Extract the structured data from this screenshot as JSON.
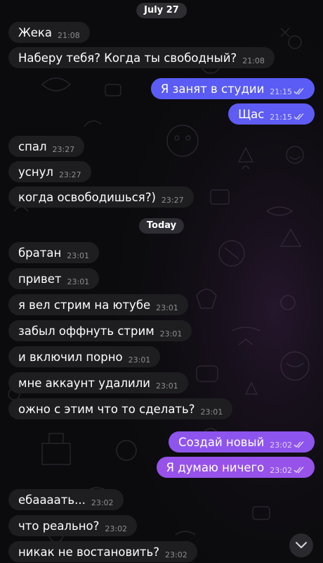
{
  "dates": {
    "first": "July 27",
    "second": "Today"
  },
  "messages": [
    {
      "text": "Жека",
      "time": "21:08",
      "dir": "in"
    },
    {
      "text": "Наберу тебя? Когда ты свободный?",
      "time": "21:08",
      "dir": "in"
    },
    {
      "text": "Я занят в студии",
      "time": "21:15",
      "dir": "out"
    },
    {
      "text": "Щас",
      "time": "21:15",
      "dir": "out"
    },
    {
      "text": "спал",
      "time": "23:27",
      "dir": "in"
    },
    {
      "text": "уснул",
      "time": "23:27",
      "dir": "in"
    },
    {
      "text": "когда освободишься?)",
      "time": "23:27",
      "dir": "in"
    },
    {
      "text": "братан",
      "time": "23:01",
      "dir": "in"
    },
    {
      "text": "привет",
      "time": "23:01",
      "dir": "in"
    },
    {
      "text": "я вел стрим на ютубе",
      "time": "23:01",
      "dir": "in"
    },
    {
      "text": "забыл оффнуть стрим",
      "time": "23:01",
      "dir": "in"
    },
    {
      "text": "и включил порно",
      "time": "23:01",
      "dir": "in"
    },
    {
      "text": "мне аккаунт удалили",
      "time": "23:01",
      "dir": "in"
    },
    {
      "text": "ожно с этим что то сделать?",
      "time": "23:01",
      "dir": "in"
    },
    {
      "text": "Создай новый",
      "time": "23:02",
      "dir": "out"
    },
    {
      "text": "Я думаю ничего",
      "time": "23:02",
      "dir": "out"
    },
    {
      "text": "ебаааать...",
      "time": "23:02",
      "dir": "in"
    },
    {
      "text": "что реально?",
      "time": "23:02",
      "dir": "in"
    },
    {
      "text": "никак не востановить?",
      "time": "23:02",
      "dir": "in"
    }
  ],
  "colors": {
    "incoming_bubble": "#1e1e21",
    "outgoing_top": "#5b5cf6",
    "outgoing_mid": "#7a5cf4",
    "outgoing_bottom": "#9a4fe8"
  },
  "icons": {
    "scroll_down": "chevron-down-icon",
    "read_status": "double-check-icon"
  }
}
